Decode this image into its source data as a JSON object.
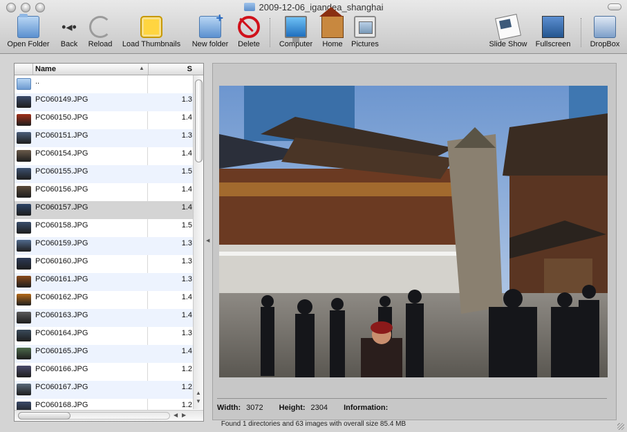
{
  "window": {
    "title": "2009-12-06_igandea_shanghai",
    "folder_icon": "folder-icon"
  },
  "toolbar": {
    "open_folder": "Open Folder",
    "back": "Back",
    "reload": "Reload",
    "load_thumbnails": "Load Thumbnails",
    "new_folder": "New folder",
    "delete": "Delete",
    "computer": "Computer",
    "home": "Home",
    "pictures": "Pictures",
    "slide_show": "Slide Show",
    "fullscreen": "Fullscreen",
    "dropbox": "DropBox"
  },
  "filelist": {
    "header_name": "Name",
    "header_size": "S",
    "parent_label": "..",
    "rows": [
      {
        "name": "PC060149.JPG",
        "size": "1.3"
      },
      {
        "name": "PC060150.JPG",
        "size": "1.4"
      },
      {
        "name": "PC060151.JPG",
        "size": "1.3"
      },
      {
        "name": "PC060154.JPG",
        "size": "1.4"
      },
      {
        "name": "PC060155.JPG",
        "size": "1.5"
      },
      {
        "name": "PC060156.JPG",
        "size": "1.4"
      },
      {
        "name": "PC060157.JPG",
        "size": "1.4"
      },
      {
        "name": "PC060158.JPG",
        "size": "1.5"
      },
      {
        "name": "PC060159.JPG",
        "size": "1.3"
      },
      {
        "name": "PC060160.JPG",
        "size": "1.3"
      },
      {
        "name": "PC060161.JPG",
        "size": "1.3"
      },
      {
        "name": "PC060162.JPG",
        "size": "1.4"
      },
      {
        "name": "PC060163.JPG",
        "size": "1.4"
      },
      {
        "name": "PC060164.JPG",
        "size": "1.3"
      },
      {
        "name": "PC060165.JPG",
        "size": "1.4"
      },
      {
        "name": "PC060166.JPG",
        "size": "1.2"
      },
      {
        "name": "PC060167.JPG",
        "size": "1.2"
      },
      {
        "name": "PC060168.JPG",
        "size": "1.2"
      }
    ],
    "selected_index": 6
  },
  "viewer": {
    "width_label": "Width:",
    "width_value": "3072",
    "height_label": "Height:",
    "height_value": "2304",
    "information_label": "Information:"
  },
  "status": "Found 1 directories and 63 images with overall size 85.4 MB",
  "colors": {
    "row_alt": "#edf3fe",
    "row_selected": "#d4d4d4",
    "sky": "#98b6d9"
  }
}
